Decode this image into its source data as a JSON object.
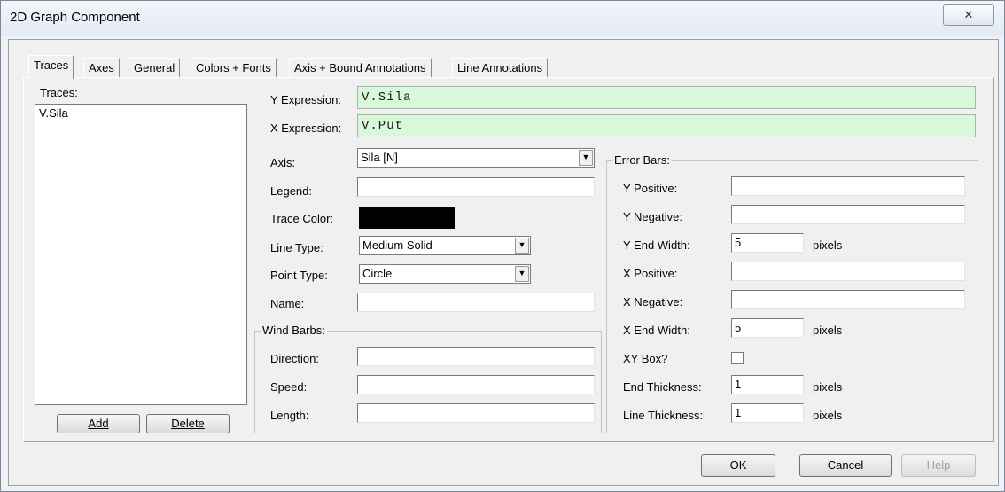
{
  "window": {
    "title": "2D Graph Component",
    "close_glyph": "✕"
  },
  "tabs": [
    {
      "label": "Traces"
    },
    {
      "label": "Axes"
    },
    {
      "label": "General"
    },
    {
      "label": "Colors + Fonts"
    },
    {
      "label": "Axis + Bound Annotations"
    },
    {
      "label": "Line Annotations"
    }
  ],
  "traces_panel": {
    "label": "Traces:",
    "items": [
      "V.Sila"
    ],
    "add_label": "Add",
    "delete_label": "Delete"
  },
  "expressions": {
    "y_label": "Y Expression:",
    "y_value": "V.Sila",
    "x_label": "X Expression:",
    "x_value": "V.Put"
  },
  "trace_props": {
    "axis_label": "Axis:",
    "axis_value": "Sila [N]",
    "legend_label": "Legend:",
    "legend_value": "",
    "trace_color_label": "Trace Color:",
    "trace_color": "#000000",
    "line_type_label": "Line Type:",
    "line_type_value": "Medium Solid",
    "point_type_label": "Point Type:",
    "point_type_value": "Circle",
    "name_label": "Name:",
    "name_value": ""
  },
  "wind_barbs": {
    "title": "Wind Barbs:",
    "direction_label": "Direction:",
    "speed_label": "Speed:",
    "length_label": "Length:"
  },
  "error_bars": {
    "title": "Error Bars:",
    "y_positive_label": "Y Positive:",
    "y_negative_label": "Y Negative:",
    "y_end_width_label": "Y End Width:",
    "y_end_width_value": "5",
    "x_positive_label": "X Positive:",
    "x_negative_label": "X Negative:",
    "x_end_width_label": "X End Width:",
    "x_end_width_value": "5",
    "xy_box_label": "XY Box?",
    "xy_box_checked": false,
    "end_thickness_label": "End Thickness:",
    "end_thickness_value": "1",
    "line_thickness_label": "Line Thickness:",
    "line_thickness_value": "1",
    "pixels_label": "pixels"
  },
  "footer": {
    "ok_label": "OK",
    "cancel_label": "Cancel",
    "help_label": "Help"
  }
}
